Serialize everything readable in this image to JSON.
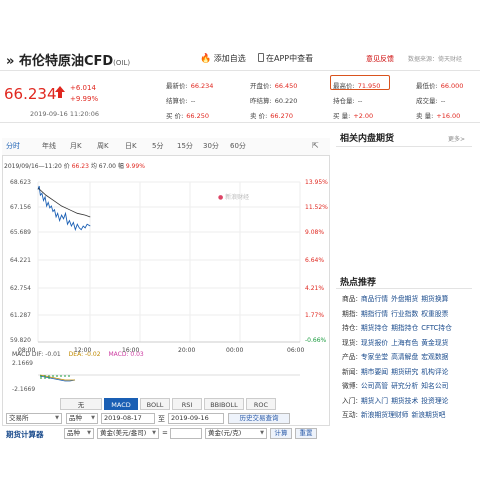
{
  "header": {
    "prefix": "»",
    "title": "布伦特原油CFD",
    "title_suffix": "(OIL)",
    "fav_icon": "flame-icon",
    "fav_label": "添加自选",
    "app_icon": "phone-icon",
    "app_label": "在APP中查看",
    "feedback_label": "意见反馈",
    "source_label": "数据来源：倚天财经"
  },
  "quote": {
    "price": "66.234",
    "direction_icon": "up-arrow-icon",
    "change": "+6.014",
    "change_pct": "+9.99%",
    "time": "2019-09-16 11:20:06",
    "fields": [
      {
        "label": "最新价:",
        "value": "66.234",
        "color": "red"
      },
      {
        "label": "开盘价:",
        "value": "66.450",
        "color": "red"
      },
      {
        "label": "最高价:",
        "value": "71.950",
        "color": "red"
      },
      {
        "label": "最低价:",
        "value": "66.000",
        "color": "red"
      },
      {
        "label": "结算价:",
        "value": "--",
        "color": ""
      },
      {
        "label": "昨结算:",
        "value": "60.220",
        "color": ""
      },
      {
        "label": "持仓量:",
        "value": "--",
        "color": ""
      },
      {
        "label": "成交量:",
        "value": "--",
        "color": ""
      },
      {
        "label": "买  价:",
        "value": "66.250",
        "color": "red"
      },
      {
        "label": "卖  价:",
        "value": "66.270",
        "color": "red"
      },
      {
        "label": "买  量:",
        "value": "+2.00",
        "color": "red"
      },
      {
        "label": "卖  量:",
        "value": "+16.00",
        "color": "red"
      }
    ]
  },
  "chart": {
    "tabs": [
      "分时",
      "年线",
      "月K",
      "周K",
      "日K",
      "5分",
      "15分",
      "30分",
      "60分"
    ],
    "active_tab": 0,
    "bar_time": "2019/09/16—11:20",
    "bar_price_label": "价",
    "bar_price": "66.23",
    "bar_vol_label": "均",
    "bar_vol": "67.00",
    "bar_pct_label": "幅",
    "bar_pct": "9.99%",
    "watermark": "新浪财经",
    "y_left": [
      "68.623",
      "67.156",
      "65.689",
      "64.221",
      "62.754",
      "61.287",
      "59.820"
    ],
    "y_right": [
      "13.95%",
      "11.52%",
      "9.08%",
      "6.64%",
      "4.21%",
      "1.77%",
      "-0.66%"
    ],
    "x_labels": [
      "08:00",
      "12:00",
      "16:00",
      "20:00",
      "00:00",
      "06:00"
    ],
    "macd_label": "MACD",
    "macd_dif": "DIF: -0.01",
    "macd_dea": "DEA: -0.02",
    "macd_val": "MACD: 0.03",
    "macd_top": "2.1669",
    "macd_bottom": "-2.1669"
  },
  "chart_data": {
    "type": "line",
    "title": "",
    "xlabel": "",
    "ylabel": "",
    "ylim": [
      59.82,
      68.623
    ],
    "x_ticks": [
      "08:00",
      "12:00",
      "16:00",
      "20:00",
      "00:00",
      "06:00"
    ],
    "series": [
      {
        "x": [
          0.0,
          0.03,
          0.06,
          0.1,
          0.14,
          0.18,
          0.22,
          0.26,
          0.3,
          0.34,
          0.38,
          0.42,
          0.46,
          0.5,
          0.55,
          0.6,
          0.65,
          0.7,
          0.75,
          0.8,
          0.85,
          0.9,
          0.95,
          1.0,
          1.05,
          1.1,
          1.15,
          1.2,
          1.25,
          1.33
        ],
        "values": [
          68.2,
          68.4,
          67.9,
          68.0,
          67.6,
          67.8,
          67.3,
          67.5,
          67.2,
          67.3,
          67.0,
          67.1,
          66.7,
          66.9,
          66.5,
          66.8,
          66.6,
          66.9,
          66.3,
          66.5,
          66.2,
          66.4,
          66.0,
          66.3,
          66.1,
          66.0,
          66.2,
          66.1,
          66.3,
          66.2
        ]
      },
      {
        "x": [
          0.0,
          0.2,
          0.4,
          0.6,
          0.8,
          1.0,
          1.2,
          1.33
        ],
        "values": [
          68.3,
          67.9,
          67.6,
          67.3,
          67.1,
          66.9,
          66.8,
          66.7
        ]
      }
    ]
  },
  "indicators": {
    "tabs": [
      "无",
      "MACD",
      "BOLL",
      "RSI",
      "BBIBOLL",
      "ROC"
    ],
    "active": 1
  },
  "filters": {
    "exchange": "交易所",
    "variety": "品种",
    "date_from": "2019-08-17",
    "to_label": "至",
    "date_to": "2019-09-16",
    "history_btn": "历史交易查询"
  },
  "calculator": {
    "title": "期货计算器",
    "variety": "品种",
    "unit_from": "黄金(美元/盎司)",
    "eq": "=",
    "unit_to": "黄金(元/克)",
    "calc_btn": "计算",
    "reset_btn": "重置"
  },
  "sidebar": {
    "related_title": "相关内盘期货",
    "more_label": "更多>",
    "hot_title": "热点推荐",
    "hot": [
      {
        "k": "商品:",
        "items": [
          "商品行情",
          "外盘期货",
          "期货换算"
        ]
      },
      {
        "k": "期指:",
        "items": [
          "期指行情",
          "行业指数",
          "权重股票"
        ]
      },
      {
        "k": "持仓:",
        "items": [
          "期货持仓",
          "期指持仓",
          "CFTC持仓"
        ]
      },
      {
        "k": "现货:",
        "items": [
          "现货报价",
          "上海有色",
          "黄金现货"
        ]
      },
      {
        "k": "产品:",
        "items": [
          "专家坐堂",
          "高清解盘",
          "宏观数据"
        ]
      },
      {
        "k": "新闻:",
        "items": [
          "期市要闻",
          "期货研究",
          "机构评论"
        ]
      },
      {
        "k": "微博:",
        "items": [
          "公司高管",
          "研究分析",
          "知名公司"
        ]
      },
      {
        "k": "入门:",
        "items": [
          "期货入门",
          "期货技术",
          "投资理论"
        ]
      },
      {
        "k": "互动:",
        "items": [
          "新浪期货理财师",
          "新浪期货吧"
        ]
      }
    ]
  }
}
